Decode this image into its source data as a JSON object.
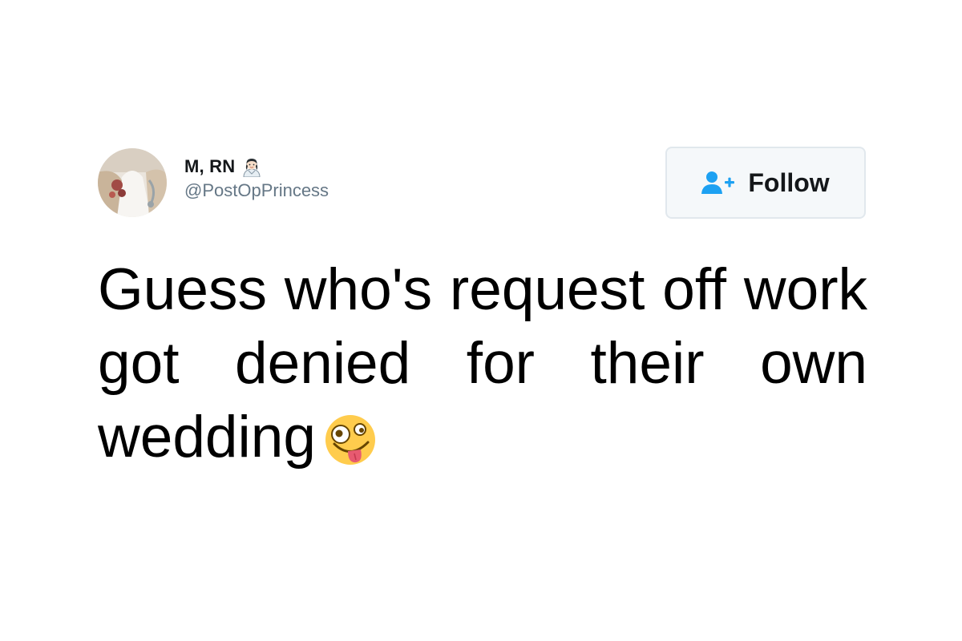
{
  "tweet": {
    "author": {
      "display_name": "M, RN",
      "name_emoji": "health-worker-woman-emoji",
      "handle": "@PostOpPrincess",
      "avatar": "profile-photo"
    },
    "follow_button": {
      "icon": "add-user-icon",
      "label": "Follow"
    },
    "text": "Guess who's request off work got denied for their own wedding",
    "text_emoji": "zany-face-emoji"
  },
  "colors": {
    "follow_icon": "#1da1f2",
    "handle": "#657786",
    "button_border": "#e1e8ed",
    "button_bg": "#f5f8fa"
  }
}
